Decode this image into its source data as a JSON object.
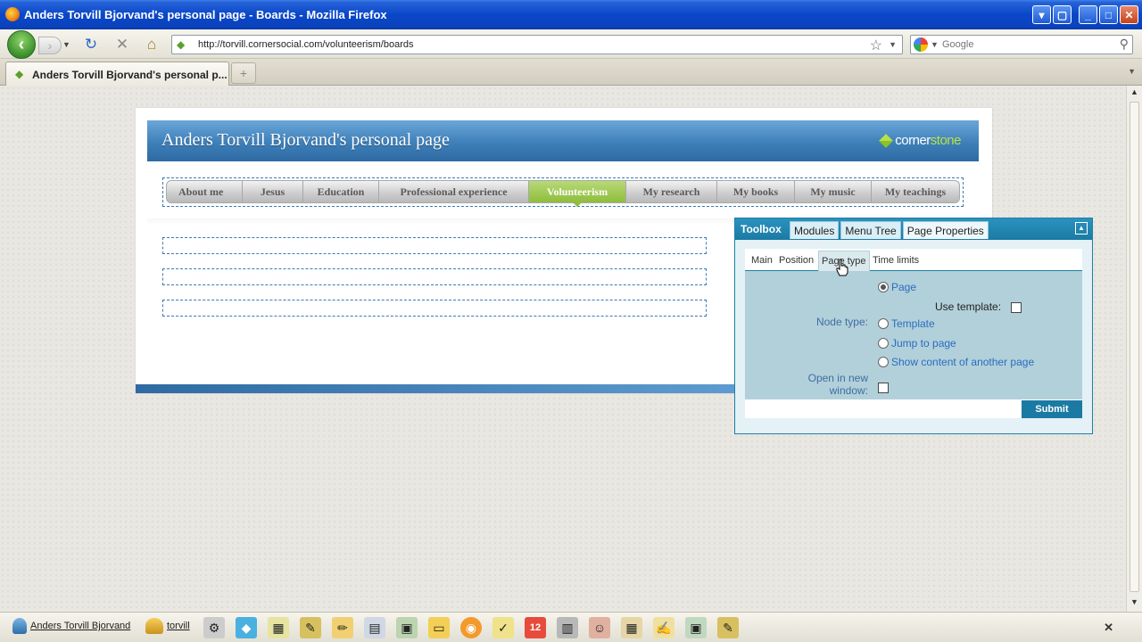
{
  "window": {
    "title": "Anders Torvill Bjorvand's personal page - Boards - Mozilla Firefox",
    "buttons": [
      "▾",
      "▢",
      "_",
      "□",
      "✕"
    ]
  },
  "navbar": {
    "back_icon": "‹",
    "forward_icon": "›",
    "history_dropdown_icon": "▼",
    "reload_icon": "↻",
    "stop_icon": "✕",
    "home_icon": "⌂",
    "url": "http://torvill.cornersocial.com/volunteerism/boards",
    "bookmark_star_icon": "☆",
    "url_dropdown_icon": "▼",
    "search_placeholder": "Google",
    "search_icon": "⚲"
  },
  "tabstrip": {
    "tab_label": "Anders Torvill Bjorvand's personal p...",
    "new_tab_label": "+",
    "tabs_dropdown_icon": "▼"
  },
  "page": {
    "title": "Anders Torvill Bjorvand's personal page",
    "brand_prefix": "corner",
    "brand_suffix": "stone",
    "menu": [
      {
        "label": "About me"
      },
      {
        "label": "Jesus"
      },
      {
        "label": "Education"
      },
      {
        "label": "Professional experience"
      },
      {
        "label": "Volunteerism",
        "active": true
      },
      {
        "label": "My research"
      },
      {
        "label": "My books"
      },
      {
        "label": "My music"
      },
      {
        "label": "My teachings"
      }
    ]
  },
  "toolbox": {
    "title": "Toolbox",
    "tabs": [
      "Modules",
      "Menu Tree",
      "Page Properties"
    ],
    "active_tab": "Page Properties",
    "minimize_icon": "▲",
    "sub_tabs": [
      "Main",
      "Position",
      "Page type",
      "Time limits"
    ],
    "active_sub_tab": "Page type",
    "page_type": {
      "page_option": "Page",
      "use_template_label": "Use template:",
      "node_type_label": "Node type:",
      "node_options": [
        "Template",
        "Jump to page",
        "Show content of another page"
      ],
      "open_new_window_label_1": "Open in new",
      "open_new_window_label_2": "window:"
    },
    "submit_label": "Submit"
  },
  "bottombar": {
    "user_label": "Anders Torvill Bjorvand",
    "group_label": "torvill",
    "close_icon": "✕"
  },
  "colors": {
    "titlebar_blue": "#0a47c8",
    "header_blue": "#3e7fb9",
    "menu_active_green": "#8fbd3c",
    "toolbox_blue": "#1b7aa3",
    "toolbox_panel": "#b2d0da"
  }
}
